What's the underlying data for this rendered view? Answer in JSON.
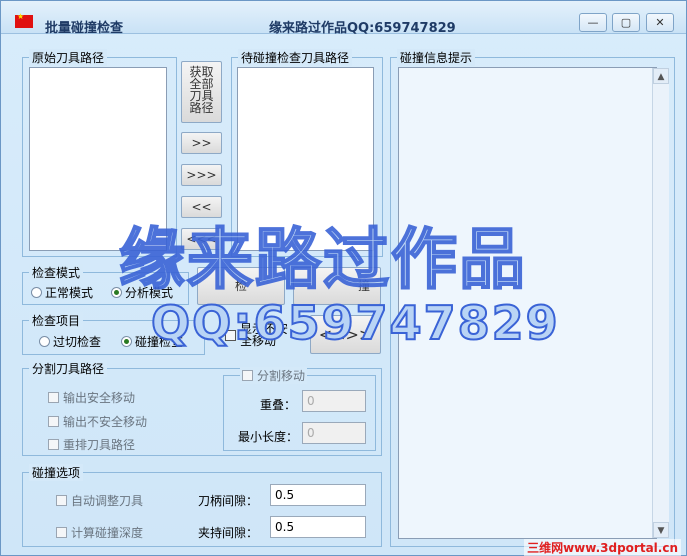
{
  "window": {
    "title": "批量碰撞检查",
    "author_text": "缘来路过作品QQ:659747829",
    "minimize": "—",
    "restore": "▢",
    "close": "✕"
  },
  "groups": {
    "source_paths": "原始刀具路径",
    "target_paths": "待碰撞检查刀具路径",
    "info": "碰撞信息提示",
    "check_mode": "检查模式",
    "check_item": "检查项目",
    "split": "分割刀具路径",
    "collision_options": "碰撞选项"
  },
  "buttons": {
    "get_all": "获取全部刀具路径",
    "add_one": ">>",
    "add_all": ">>>",
    "remove_one": "<<",
    "remove_all": "<<<",
    "check": "检",
    "collide": "撞",
    "swap": "<<>>"
  },
  "check_mode": {
    "normal": "正常模式",
    "analysis": "分析模式",
    "selected": "analysis"
  },
  "check_item": {
    "cut": "过切检查",
    "collision": "碰撞检查",
    "selected": "collision",
    "show_unsafe": "显示不安全移动"
  },
  "split": {
    "output_safe": "输出安全移动",
    "output_unsafe": "输出不安全移动",
    "reorder": "重排刀具路径",
    "split_move": "分割移动",
    "overlap_label": "重叠：",
    "overlap_value": "0",
    "min_length_label": "最小长度：",
    "min_length_value": "0"
  },
  "collision_options": {
    "auto_adjust": "自动调整刀具",
    "calc_depth": "计算碰撞深度",
    "shank_label": "刀柄间隙：",
    "shank_value": "0.5",
    "holder_label": "夹持间隙：",
    "holder_value": "0.5"
  },
  "overlay": {
    "line1": "缘来路过作品",
    "line2": "QQ:659747829"
  },
  "background_text": "路",
  "watermark": "三维网www.3dportal.cn"
}
